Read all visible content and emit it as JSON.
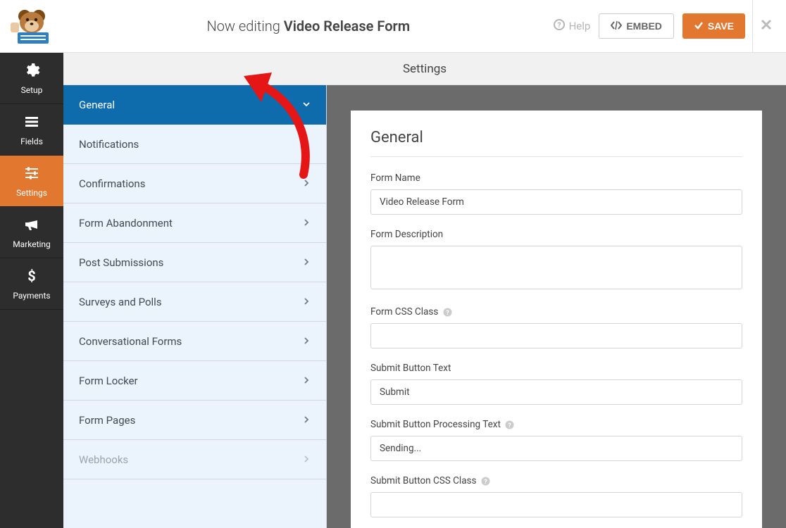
{
  "header": {
    "editing_prefix": "Now editing ",
    "form_title": "Video Release Form",
    "help_label": "Help",
    "embed_label": "EMBED",
    "save_label": "SAVE"
  },
  "leftnav": {
    "items": [
      {
        "key": "setup",
        "label": "Setup"
      },
      {
        "key": "fields",
        "label": "Fields"
      },
      {
        "key": "settings",
        "label": "Settings"
      },
      {
        "key": "marketing",
        "label": "Marketing"
      },
      {
        "key": "payments",
        "label": "Payments"
      }
    ],
    "active": "settings"
  },
  "content_header": "Settings",
  "settings_menu": [
    {
      "label": "General",
      "selected": true
    },
    {
      "label": "Notifications"
    },
    {
      "label": "Confirmations"
    },
    {
      "label": "Form Abandonment"
    },
    {
      "label": "Post Submissions"
    },
    {
      "label": "Surveys and Polls"
    },
    {
      "label": "Conversational Forms"
    },
    {
      "label": "Form Locker"
    },
    {
      "label": "Form Pages"
    },
    {
      "label": "Webhooks",
      "disabled": true
    }
  ],
  "panel": {
    "title": "General",
    "fields": {
      "form_name": {
        "label": "Form Name",
        "value": "Video Release Form"
      },
      "form_description": {
        "label": "Form Description",
        "value": ""
      },
      "form_css_class": {
        "label": "Form CSS Class",
        "value": ""
      },
      "submit_button_text": {
        "label": "Submit Button Text",
        "value": "Submit"
      },
      "submit_button_processing": {
        "label": "Submit Button Processing Text",
        "value": "Sending..."
      },
      "submit_button_css_class": {
        "label": "Submit Button CSS Class",
        "value": ""
      }
    }
  }
}
